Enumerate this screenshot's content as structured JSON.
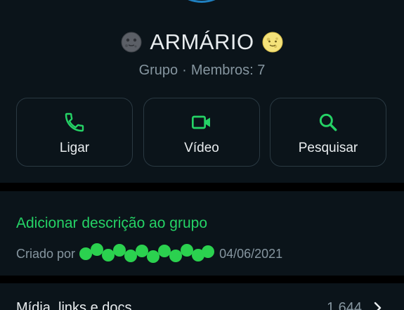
{
  "group": {
    "title": "ARMÁRIO",
    "emoji_left": "new-moon-face-emoji",
    "emoji_right": "full-moon-face-emoji",
    "type": "Grupo",
    "members_label": "Membros: 7"
  },
  "actions": [
    {
      "label": "Ligar",
      "icon": "phone-icon"
    },
    {
      "label": "Vídeo",
      "icon": "video-camera-icon"
    },
    {
      "label": "Pesquisar",
      "icon": "search-icon"
    }
  ],
  "description": {
    "add_label": "Adicionar descrição ao grupo",
    "created_prefix": "Criado por",
    "created_date": "04/06/2021"
  },
  "media": {
    "label": "Mídia, links e docs",
    "count": "1.644"
  },
  "colors": {
    "accent": "#25d366",
    "background": "#0b141a",
    "text_primary": "#e9edef",
    "text_secondary": "#8696a0",
    "avatar_ring": "#1f7fbf"
  }
}
